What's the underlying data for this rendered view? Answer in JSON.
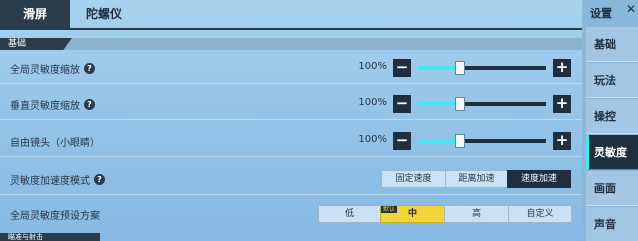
{
  "tabs": [
    {
      "label": "滑屏",
      "active": true
    },
    {
      "label": "陀螺仪",
      "active": false
    }
  ],
  "section_basic": "基础",
  "rows": [
    {
      "label": "全局灵敏度缩放",
      "help": true,
      "value": "100%",
      "fraction": 0.33
    },
    {
      "label": "垂直灵敏度缩放",
      "help": true,
      "value": "100%",
      "fraction": 0.33
    },
    {
      "label": "自由镜头（小眼睛）",
      "help": false,
      "value": "100%",
      "fraction": 0.33
    }
  ],
  "accel_mode": {
    "label": "灵敏度加速度模式",
    "options": [
      "固定速度",
      "距离加速",
      "速度加速"
    ],
    "selected": "速度加速"
  },
  "preset": {
    "label": "全局灵敏度预设方案",
    "options": [
      "低",
      "中",
      "高",
      "自定义"
    ],
    "selected": "中",
    "badge": "默认"
  },
  "next_section": "瞄准与射击",
  "sidebar": {
    "title": "设置",
    "close": "✕",
    "items": [
      "基础",
      "玩法",
      "操控",
      "灵敏度",
      "画面",
      "声音"
    ],
    "active": "灵敏度"
  },
  "colors": {
    "accent": "#46e8f0",
    "dark": "#1f2f40",
    "highlight": "#f2d338"
  },
  "icons": {
    "help": "question-circle-icon",
    "minus": "minus-icon",
    "plus": "plus-icon",
    "close": "close-icon"
  }
}
